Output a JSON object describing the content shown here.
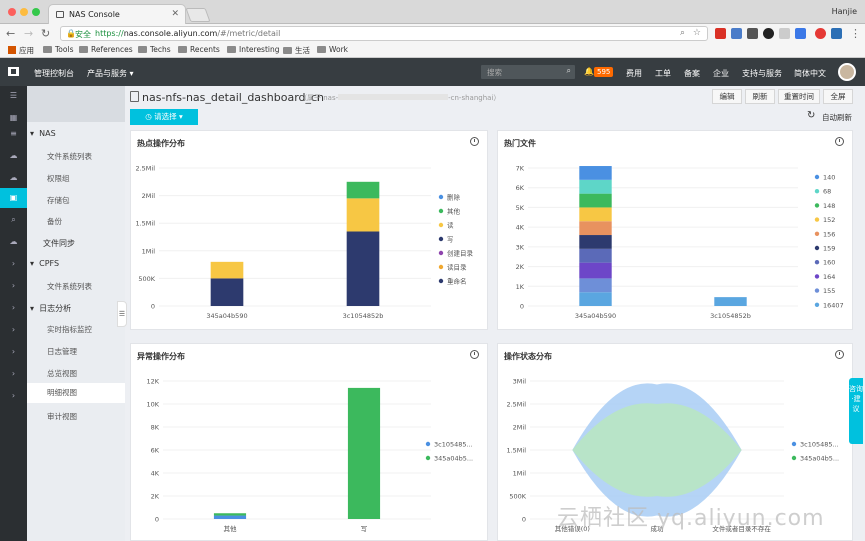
{
  "browser": {
    "tab_title": "NAS Console",
    "user": "Hanjie",
    "secure_label": "安全",
    "url_scheme": "https://",
    "url_domain": "nas.console.aliyun.com",
    "url_path": "/#/metric/detail",
    "bookmarks": [
      "应用",
      "Tools",
      "References",
      "Techs",
      "Recents",
      "Interesting",
      "生活",
      "Work"
    ]
  },
  "header": {
    "console_label": "管理控制台",
    "products_label": "产品与服务",
    "search_placeholder": "搜索",
    "badge": "595",
    "links": [
      "费用",
      "工单",
      "备案",
      "企业",
      "支持与服务",
      "简体中文"
    ]
  },
  "sidebar": {
    "groups": [
      {
        "label": "NAS",
        "items": [
          "文件系统列表",
          "权限组",
          "存储包",
          "备份"
        ]
      },
      {
        "label": "文件同步",
        "items": []
      },
      {
        "label": "CPFS",
        "items": [
          "文件系统列表"
        ]
      },
      {
        "label": "日志分析",
        "items": [
          "实时指标监控",
          "日志管理",
          "总览视图",
          "明细视图",
          "审计视图"
        ]
      }
    ],
    "active_item": "明细视图"
  },
  "page": {
    "title": "nas-nfs-nas_detail_dashboard_cn",
    "region_prefix": "（属于 nas-",
    "region_suffix": "-cn-shanghai）",
    "buttons": [
      "编辑",
      "刷新",
      "重置时间",
      "全屏"
    ],
    "select_label": "请选择",
    "auto_refresh": "自动刷新"
  },
  "colors": {
    "accent": "#00c1de",
    "navy": "#2d3a6e",
    "yellow": "#f7c744",
    "green": "#3cb95d",
    "blue": "#4a90e2"
  },
  "chart_data": [
    {
      "title": "热点操作分布",
      "type": "bar",
      "stacked": true,
      "categories": [
        "345a04b590",
        "3c1054852b"
      ],
      "ylim": [
        0,
        2500000
      ],
      "yticks": [
        "0",
        "500K",
        "1Mil",
        "1.5Mil",
        "2Mil",
        "2.5Mil"
      ],
      "legend": [
        "删除",
        "其他",
        "读",
        "写",
        "创建目录",
        "读目录",
        "重命名"
      ],
      "legend_colors": [
        "#4a90e2",
        "#3cb95d",
        "#f7c744",
        "#2d3a6e",
        "#8e44ad",
        "#f0a830",
        "#2d3a6e"
      ],
      "series": [
        {
          "name": "写",
          "values": [
            500000,
            1350000
          ]
        },
        {
          "name": "读",
          "values": [
            300000,
            600000
          ]
        },
        {
          "name": "其他",
          "values": [
            0,
            300000
          ]
        }
      ]
    },
    {
      "title": "热门文件",
      "type": "bar",
      "stacked": true,
      "categories": [
        "345a04b590",
        "3c1054852b"
      ],
      "ylim": [
        0,
        7000
      ],
      "yticks": [
        "0",
        "1K",
        "2K",
        "3K",
        "4K",
        "5K",
        "6K",
        "7K"
      ],
      "legend": [
        "140",
        "68",
        "148",
        "152",
        "156",
        "159",
        "160",
        "164",
        "155",
        "16407"
      ],
      "legend_colors": [
        "#4a90e2",
        "#5ed6c8",
        "#3cb95d",
        "#f7c744",
        "#e8925f",
        "#2d3a6e",
        "#5b6ab8",
        "#6d46c8",
        "#6e8fd8",
        "#5aa6e0"
      ],
      "series": [
        {
          "name": "16407",
          "values": [
            700,
            450
          ]
        },
        {
          "name": "155",
          "values": [
            700,
            0
          ]
        },
        {
          "name": "164",
          "values": [
            800,
            0
          ]
        },
        {
          "name": "160",
          "values": [
            700,
            0
          ]
        },
        {
          "name": "159",
          "values": [
            700,
            0
          ]
        },
        {
          "name": "156",
          "values": [
            700,
            0
          ]
        },
        {
          "name": "152",
          "values": [
            700,
            0
          ]
        },
        {
          "name": "148",
          "values": [
            700,
            0
          ]
        },
        {
          "name": "68",
          "values": [
            700,
            0
          ]
        },
        {
          "name": "140",
          "values": [
            700,
            0
          ]
        }
      ]
    },
    {
      "title": "异常操作分布",
      "type": "bar",
      "stacked": true,
      "categories": [
        "其他",
        "写"
      ],
      "ylim": [
        0,
        12000
      ],
      "yticks": [
        "0",
        "2K",
        "4K",
        "6K",
        "8K",
        "10K",
        "12K"
      ],
      "legend": [
        "3c105485...",
        "345a04b5..."
      ],
      "legend_colors": [
        "#4a90e2",
        "#3cb95d"
      ],
      "series": [
        {
          "name": "3c105485...",
          "values": [
            300,
            0
          ]
        },
        {
          "name": "345a04b5...",
          "values": [
            200,
            11400
          ]
        }
      ]
    },
    {
      "title": "操作状态分布",
      "type": "area",
      "categories": [
        "其他错误(0)",
        "成功",
        "文件或者目录不存在"
      ],
      "ylim": [
        0,
        3000000
      ],
      "yticks": [
        "0",
        "500K",
        "1Mil",
        "1.5Mil",
        "2Mil",
        "2.5Mil",
        "3Mil"
      ],
      "legend": [
        "3c105485...",
        "345a04b5..."
      ],
      "legend_colors": [
        "#a8cdf5",
        "#b8e6c0"
      ],
      "series": [
        {
          "name": "3c105485...",
          "values": [
            0,
            2850000,
            0
          ]
        },
        {
          "name": "345a04b5...",
          "values": [
            0,
            2000000,
            0
          ]
        }
      ]
    }
  ],
  "watermark": "云栖社区 yq.aliyun.com",
  "float_button": "咨询·建议"
}
